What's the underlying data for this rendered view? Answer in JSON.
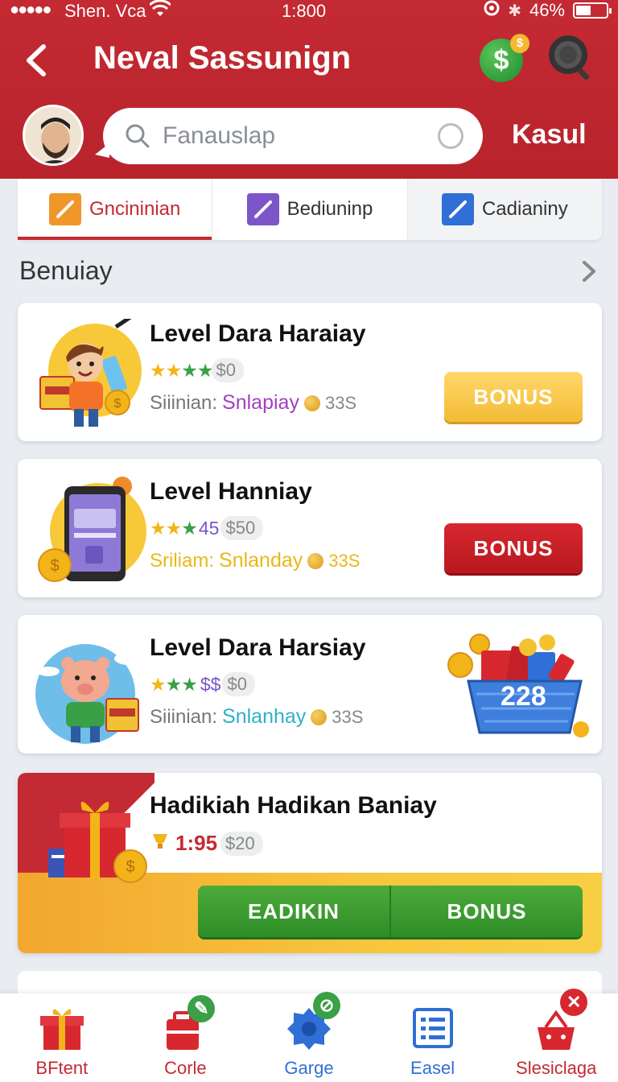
{
  "status_bar": {
    "signal": "●●●●●",
    "carrier": "Shen. Vca",
    "time": "1:800",
    "battery": "46%"
  },
  "header": {
    "title": "Neval Sassunign",
    "search_placeholder": "Fanauslap",
    "cancel_label": "Kasul",
    "coin_symbol": "$",
    "coin_mini": "$"
  },
  "tabs": [
    {
      "label": "Gncininian",
      "color": "#f0972a",
      "active": true
    },
    {
      "label": "Bediuninp",
      "color": "#7b55c9",
      "active": false
    },
    {
      "label": "Cadianiny",
      "color": "#2f6fd6",
      "active": false
    }
  ],
  "section": {
    "title": "Benuiay"
  },
  "cards": [
    {
      "title": "Level Dara Haraiay",
      "rating_value": "$0",
      "meta_label": "Siiinian:",
      "meta_highlight": "Snlapiay",
      "highlight_color": "#a23fc0",
      "meta_num": "33S",
      "button": "BONUS"
    },
    {
      "title": "Level Hanniay",
      "rating_value": "45",
      "rating_pill": "$50",
      "meta_label": "Sriliam:",
      "meta_highlight": "Snlanday",
      "highlight_color": "#e8b919",
      "meta_num": "33S",
      "button": "BONUS"
    },
    {
      "title": "Level Dara Harsiay",
      "rating_value": "$$",
      "rating_pill": "$0",
      "meta_label": "Siiinian:",
      "meta_highlight": "Snlanhay",
      "highlight_color": "#2fb1c9",
      "meta_num": "33S",
      "basket_number": "228"
    }
  ],
  "promo": {
    "title": "Hadikiah Hadikan Baniay",
    "rate": "1:95",
    "pill": "$20",
    "left_button": "EADIKIN",
    "right_button": "BONUS"
  },
  "bottom_nav": [
    {
      "label": "BFtent",
      "color": "#c42a33"
    },
    {
      "label": "Corle",
      "color": "#c42a33"
    },
    {
      "label": "Garge",
      "color": "#2f6fd6"
    },
    {
      "label": "Easel",
      "color": "#2f6fd6"
    },
    {
      "label": "Slesiclaga",
      "color": "#c42a33"
    }
  ]
}
